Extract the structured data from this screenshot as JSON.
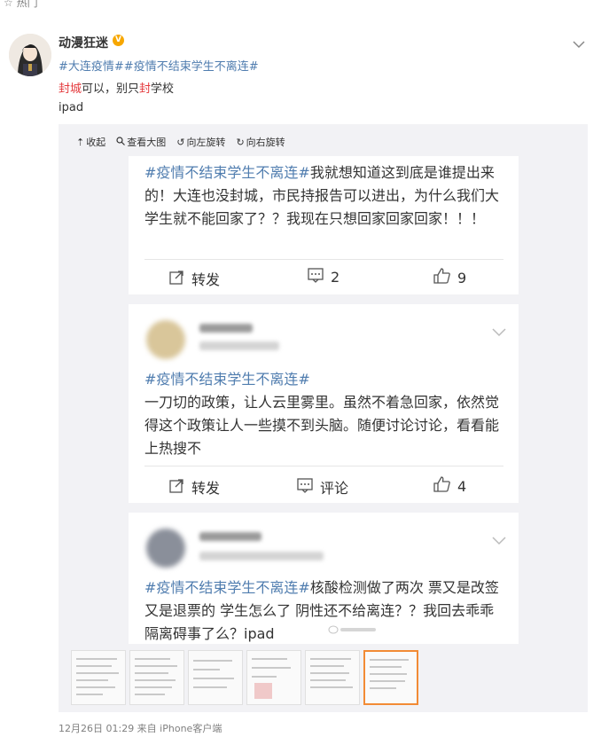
{
  "header": {
    "hot_label": "热门"
  },
  "post": {
    "username": "动漫狂迷",
    "verified_badge": "V",
    "tag1": "#大连疫情#",
    "tag2": "#疫情不结束学生不离连#",
    "line2_a": "封城",
    "line2_b": "可以，别只",
    "line2_c": "封",
    "line2_d": "学校",
    "line3": "ipad",
    "footer": "12月26日 01:29  来自 iPhone客户端"
  },
  "toolbar": {
    "collapse": "收起",
    "view_large": "查看大图",
    "rotate_left": "向左旋转",
    "rotate_right": "向右旋转"
  },
  "cards": [
    {
      "hashtag": "#疫情不结束学生不离连#",
      "text": "我就想知道这到底是谁提出来的！大连也没封城，市民持报告可以进出，为什么我们大学生就不能回家了？？我现在只想回家回家回家！！！",
      "forward": "转发",
      "comment": "2",
      "like": "9"
    },
    {
      "hashtag": "#疫情不结束学生不离连#",
      "text": "一刀切的政策，让人云里雾里。虽然不着急回家，依然觉得这个政策让人一些摸不到头脑。随便讨论讨论，看看能上热搜不",
      "forward": "转发",
      "comment": "评论",
      "like": "4"
    },
    {
      "hashtag": "#疫情不结束学生不离连#",
      "text": "核酸检测做了两次 票又是改签 又是退票的 学生怎么了 阴性还不给离连？？我回去乖乖隔离碍事了么？ipad"
    }
  ],
  "colors": {
    "link": "#507daf",
    "orange": "#eb7350",
    "red": "#e4393c",
    "panel": "#f2f2f5",
    "selected": "#f28b35"
  }
}
